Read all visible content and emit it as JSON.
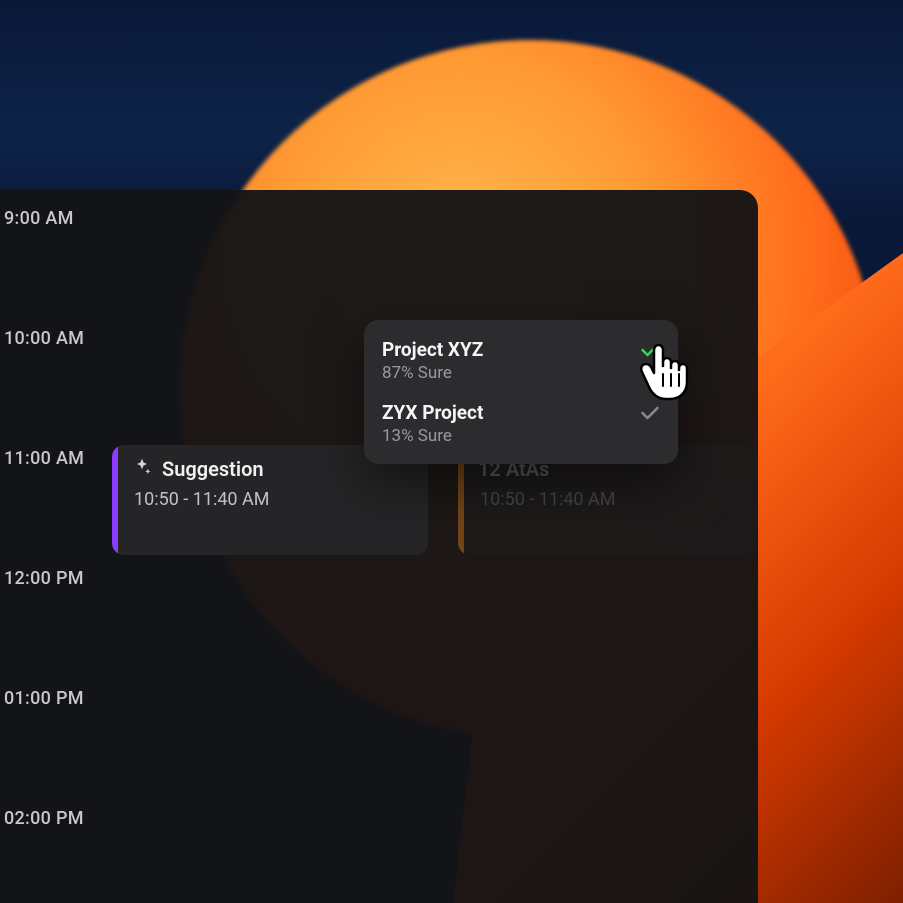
{
  "colors": {
    "accent_purple": "#8b3dff",
    "accent_orange": "#b86b1a",
    "check_green": "#35d351",
    "check_grey": "#8a8a8e"
  },
  "timeline": {
    "hours": [
      "9:00 AM",
      "10:00 AM",
      "11:00 AM",
      "12:00 PM",
      "01:00 PM",
      "02:00 PM"
    ]
  },
  "events": {
    "suggestion": {
      "title": "Suggestion",
      "time": "10:50 - 11:40 AM",
      "icon": "sparkle-icon"
    },
    "atas": {
      "title": "12 AtAs",
      "time": "10:50 - 11:40 AM"
    }
  },
  "popup": {
    "items": [
      {
        "title": "Project XYZ",
        "confidence": "87% Sure",
        "check": "green"
      },
      {
        "title": "ZYX Project",
        "confidence": "13% Sure",
        "check": "grey"
      }
    ]
  }
}
